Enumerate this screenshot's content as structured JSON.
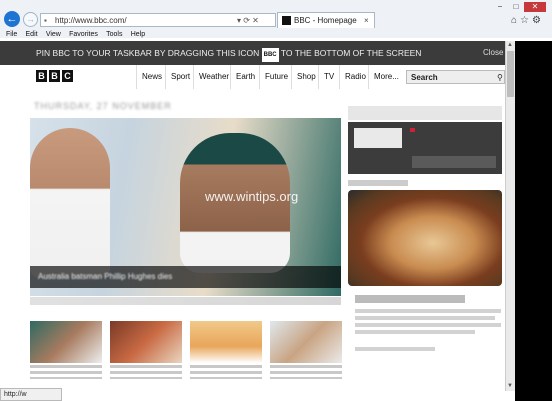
{
  "browser": {
    "address": "http://www.bbc.com/",
    "address_tools": "▾ ⟳ ✕",
    "tab_title": "BBC - Homepage",
    "tab_close": "×",
    "menu": [
      "File",
      "Edit",
      "View",
      "Favorites",
      "Tools",
      "Help"
    ],
    "window_controls": [
      "−",
      "□",
      "✕"
    ],
    "right_tools": "⌂☆⚙",
    "status_text": "http://w"
  },
  "banner": {
    "text_before": "PIN BBC TO YOUR TASKBAR BY DRAGGING THIS ICON",
    "icon_text": "BBC",
    "text_after": "TO THE BOTTOM OF THE SCREEN",
    "close_label": "Close"
  },
  "bbc": {
    "logo": [
      "B",
      "B",
      "C"
    ],
    "nav": [
      "News",
      "Sport",
      "Weather",
      "Earth",
      "Future",
      "Shop",
      "TV",
      "Radio",
      "More..."
    ],
    "search_label": "Search",
    "date_label": "THURSDAY, 27 NOVEMBER",
    "hero_caption": "Australia batsman Phillip Hughes dies",
    "watermark": "www.wintips.org"
  },
  "colors": {
    "banner_bg": "#3b3b3b",
    "ie_blue": "#1d74d3",
    "close_red": "#c7383a"
  }
}
